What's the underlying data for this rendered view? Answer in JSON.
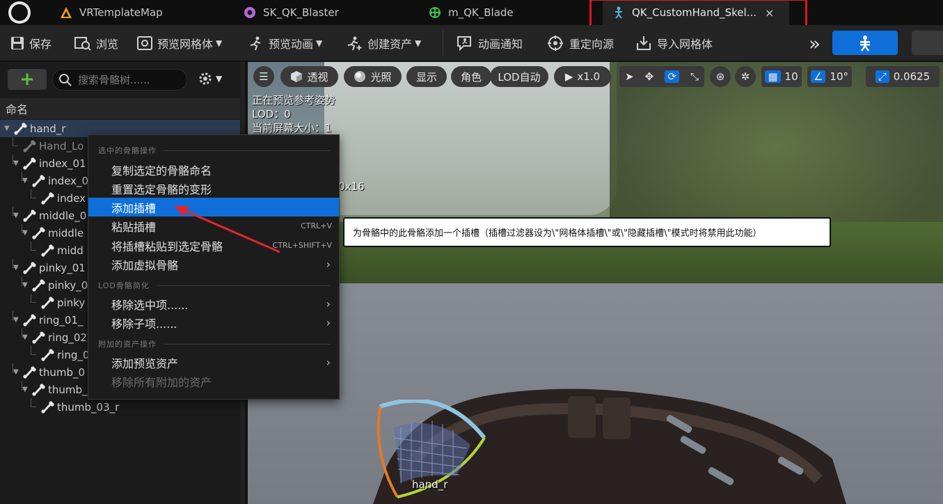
{
  "tabs": [
    {
      "label": "VRTemplateMap",
      "icon": "level-icon"
    },
    {
      "label": "SK_QK_Blaster",
      "icon": "skeletal-mesh-icon"
    },
    {
      "label": "m_QK_Blade",
      "icon": "material-icon"
    },
    {
      "label": "QK_CustomHand_Skel...",
      "icon": "skeleton-icon",
      "close": "×",
      "active": true
    }
  ],
  "toolbar": {
    "save": "保存",
    "browse": "浏览",
    "preview_mesh": "预览网格体",
    "preview_anim": "预览动画",
    "create_asset": "创建资产",
    "anim_notify": "动画通知",
    "retarget": "重定向源",
    "import_mesh": "导入网格体",
    "more": "»"
  },
  "left": {
    "add": "+",
    "search_placeholder": "搜索骨骼树......",
    "column_header": "命名",
    "tree": [
      {
        "label": "hand_r"
      },
      {
        "label": "Hand_Lo"
      },
      {
        "label": "index_01"
      },
      {
        "label": "index_0"
      },
      {
        "label": "index"
      },
      {
        "label": "middle_0"
      },
      {
        "label": "middle"
      },
      {
        "label": "midd"
      },
      {
        "label": "pinky_01"
      },
      {
        "label": "pinky_0"
      },
      {
        "label": "pinky"
      },
      {
        "label": "ring_01_"
      },
      {
        "label": "ring_02"
      },
      {
        "label": "ring_0"
      },
      {
        "label": "thumb_0"
      },
      {
        "label": "thumb_"
      },
      {
        "label": "thumb_03_r"
      }
    ]
  },
  "menu": {
    "section1": "选中的骨骼操作",
    "copy_names": "复制选定的骨骼命名",
    "reset_transform": "重置选定骨骼的变形",
    "add_socket": "添加插槽",
    "paste_socket": "粘贴插槽",
    "paste_socket_short": "CTRL+V",
    "paste_to_bone": "将插槽粘贴到选定骨骼",
    "paste_to_bone_short": "CTRL+SHIFT+V",
    "add_virtual": "添加虚拟骨骼",
    "section2": "LOD骨骼简化",
    "remove_selected": "移除选中项......",
    "remove_children": "移除子项......",
    "section3": "附加的资产操作",
    "add_preview_asset": "添加预览资产",
    "remove_attached": "移除所有附加的资产"
  },
  "tooltip": "为骨骼中的此骨骼添加一个插槽（插槽过滤器设为\\\"网格体插槽\\\"或\\\"隐藏插槽\\\"模式时将禁用此功能）",
  "viewport": {
    "perspective": "透视",
    "lighting": "光照",
    "show": "显示",
    "character": "角色",
    "lod": "LOD自动",
    "play_speed": "x1.0",
    "grid": "10",
    "angle": "10°",
    "scale": "0.0625",
    "overlay1": "正在预览参考姿势",
    "overlay2": "LOD：0",
    "overlay3": "当前屏幕大小：1",
    "overlay4": "0x16",
    "bone_label": "hand_r"
  },
  "colors": {
    "accent": "#0e6fd8",
    "highlight_box": "#e0141e",
    "arrow": "#e0252e"
  }
}
